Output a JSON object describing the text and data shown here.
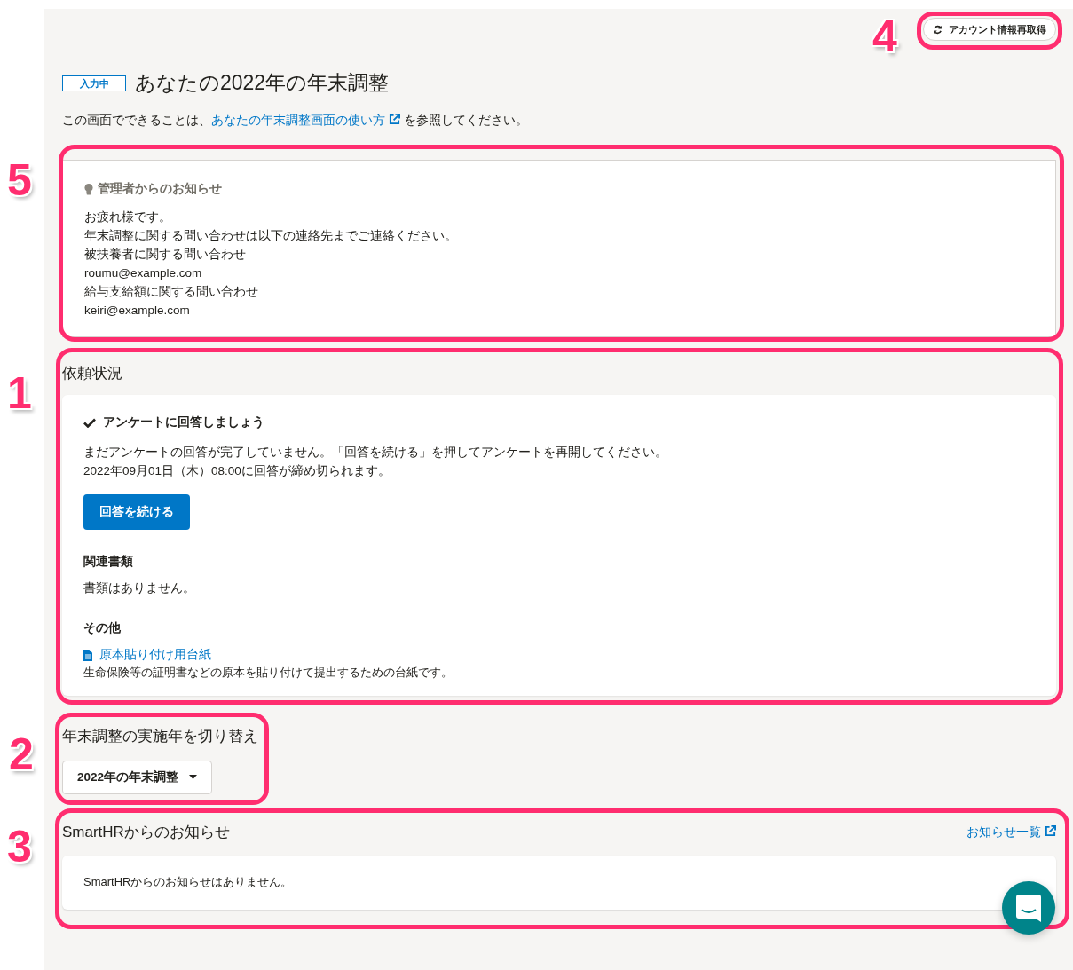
{
  "header": {
    "refresh_button": "アカウント情報再取得",
    "refresh_callout": "4",
    "status_badge": "入力中",
    "title": "あなたの2022年の年末調整",
    "intro": {
      "before": "この画面でできることは、",
      "link": "あなたの年末調整画面の使い方",
      "after": "を参照してください。"
    }
  },
  "admin_notice": {
    "callout": "5",
    "title": "管理者からのお知らせ",
    "lines": [
      "お疲れ様です。",
      "年末調整に関する問い合わせは以下の連絡先までご連絡ください。",
      "被扶養者に関する問い合わせ",
      "roumu@example.com",
      "給与支給額に関する問い合わせ",
      "keiri@example.com"
    ]
  },
  "requests": {
    "callout": "1",
    "heading": "依頼状況",
    "task_title": "アンケートに回答しましょう",
    "description": [
      "まだアンケートの回答が完了していません。「回答を続ける」を押してアンケートを再開してください。",
      "2022年09月01日（木）08:00に回答が締め切られます。"
    ],
    "button": "回答を続ける",
    "documents_heading": "関連書類",
    "documents_empty": "書類はありません。",
    "other_heading": "その他",
    "other_link": "原本貼り付け用台紙",
    "other_note": "生命保険等の証明書などの原本を貼り付けて提出するための台紙です。"
  },
  "year_switch": {
    "callout": "2",
    "heading": "年末調整の実施年を切り替え",
    "dropdown": "2022年の年末調整"
  },
  "smarthr_news": {
    "callout": "3",
    "heading": "SmartHRからのお知らせ",
    "link": "お知らせ一覧",
    "empty": "SmartHRからのお知らせはありません。"
  }
}
